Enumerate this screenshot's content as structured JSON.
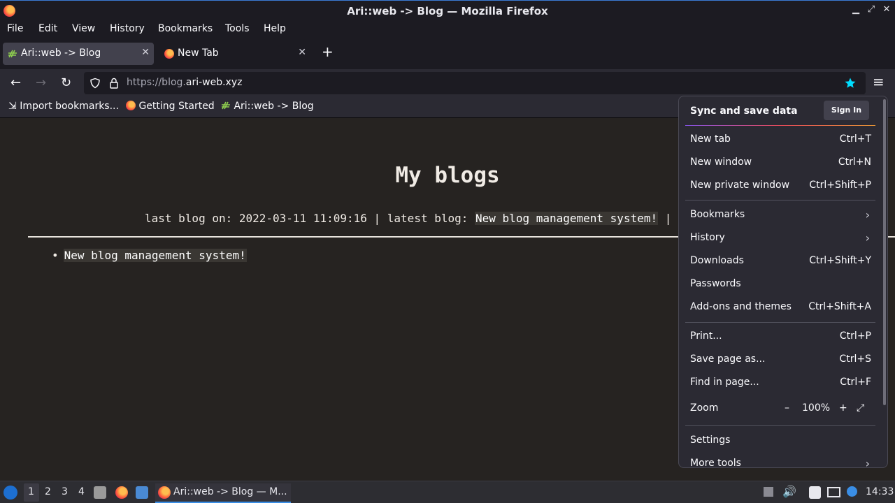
{
  "window": {
    "title": "Ari::web -> Blog — Mozilla Firefox",
    "min": "▁",
    "max": "⤢",
    "close": "✕"
  },
  "menubar": [
    "File",
    "Edit",
    "View",
    "History",
    "Bookmarks",
    "Tools",
    "Help"
  ],
  "tabs": [
    {
      "label": "Ari::web -> Blog",
      "close": "✕"
    },
    {
      "label": "New Tab",
      "close": "✕"
    }
  ],
  "newtab": "+",
  "nav": {
    "back": "←",
    "forward": "→",
    "reload": "↻",
    "url_prefix": "https://blog.",
    "url_domain": "ari-web.xyz",
    "menu": "≡"
  },
  "bookmarks": [
    "Import bookmarks...",
    "Getting Started",
    "Ari::web -> Blog"
  ],
  "page": {
    "title": "My blogs",
    "meta_prefix": "last blog on: 2022-03-11 11:09:16 | latest blog: ",
    "meta_latest": "New blog management system!",
    "meta_suffix": " | s",
    "posts": [
      "New blog management system!"
    ]
  },
  "panel": {
    "sync_title": "Sync and save data",
    "sign_in": "Sign In",
    "items": [
      {
        "label": "New tab",
        "shortcut": "Ctrl+T"
      },
      {
        "label": "New window",
        "shortcut": "Ctrl+N"
      },
      {
        "label": "New private window",
        "shortcut": "Ctrl+Shift+P"
      },
      {
        "label": "Bookmarks",
        "shortcut": ""
      },
      {
        "label": "History",
        "shortcut": ""
      },
      {
        "label": "Downloads",
        "shortcut": "Ctrl+Shift+Y"
      },
      {
        "label": "Passwords",
        "shortcut": ""
      },
      {
        "label": "Add-ons and themes",
        "shortcut": "Ctrl+Shift+A"
      },
      {
        "label": "Print...",
        "shortcut": "Ctrl+P"
      },
      {
        "label": "Save page as...",
        "shortcut": "Ctrl+S"
      },
      {
        "label": "Find in page...",
        "shortcut": "Ctrl+F"
      },
      {
        "label": "Zoom",
        "shortcut": ""
      },
      {
        "label": "Settings",
        "shortcut": ""
      },
      {
        "label": "More tools",
        "shortcut": ""
      }
    ],
    "zoom": {
      "minus": "–",
      "value": "100%",
      "plus": "+",
      "full": "⤢"
    },
    "chevron": "›"
  },
  "taskbar": {
    "workspaces": [
      "1",
      "2",
      "3",
      "4"
    ],
    "window": "Ari::web -> Blog — M...",
    "clock": "14:33"
  }
}
